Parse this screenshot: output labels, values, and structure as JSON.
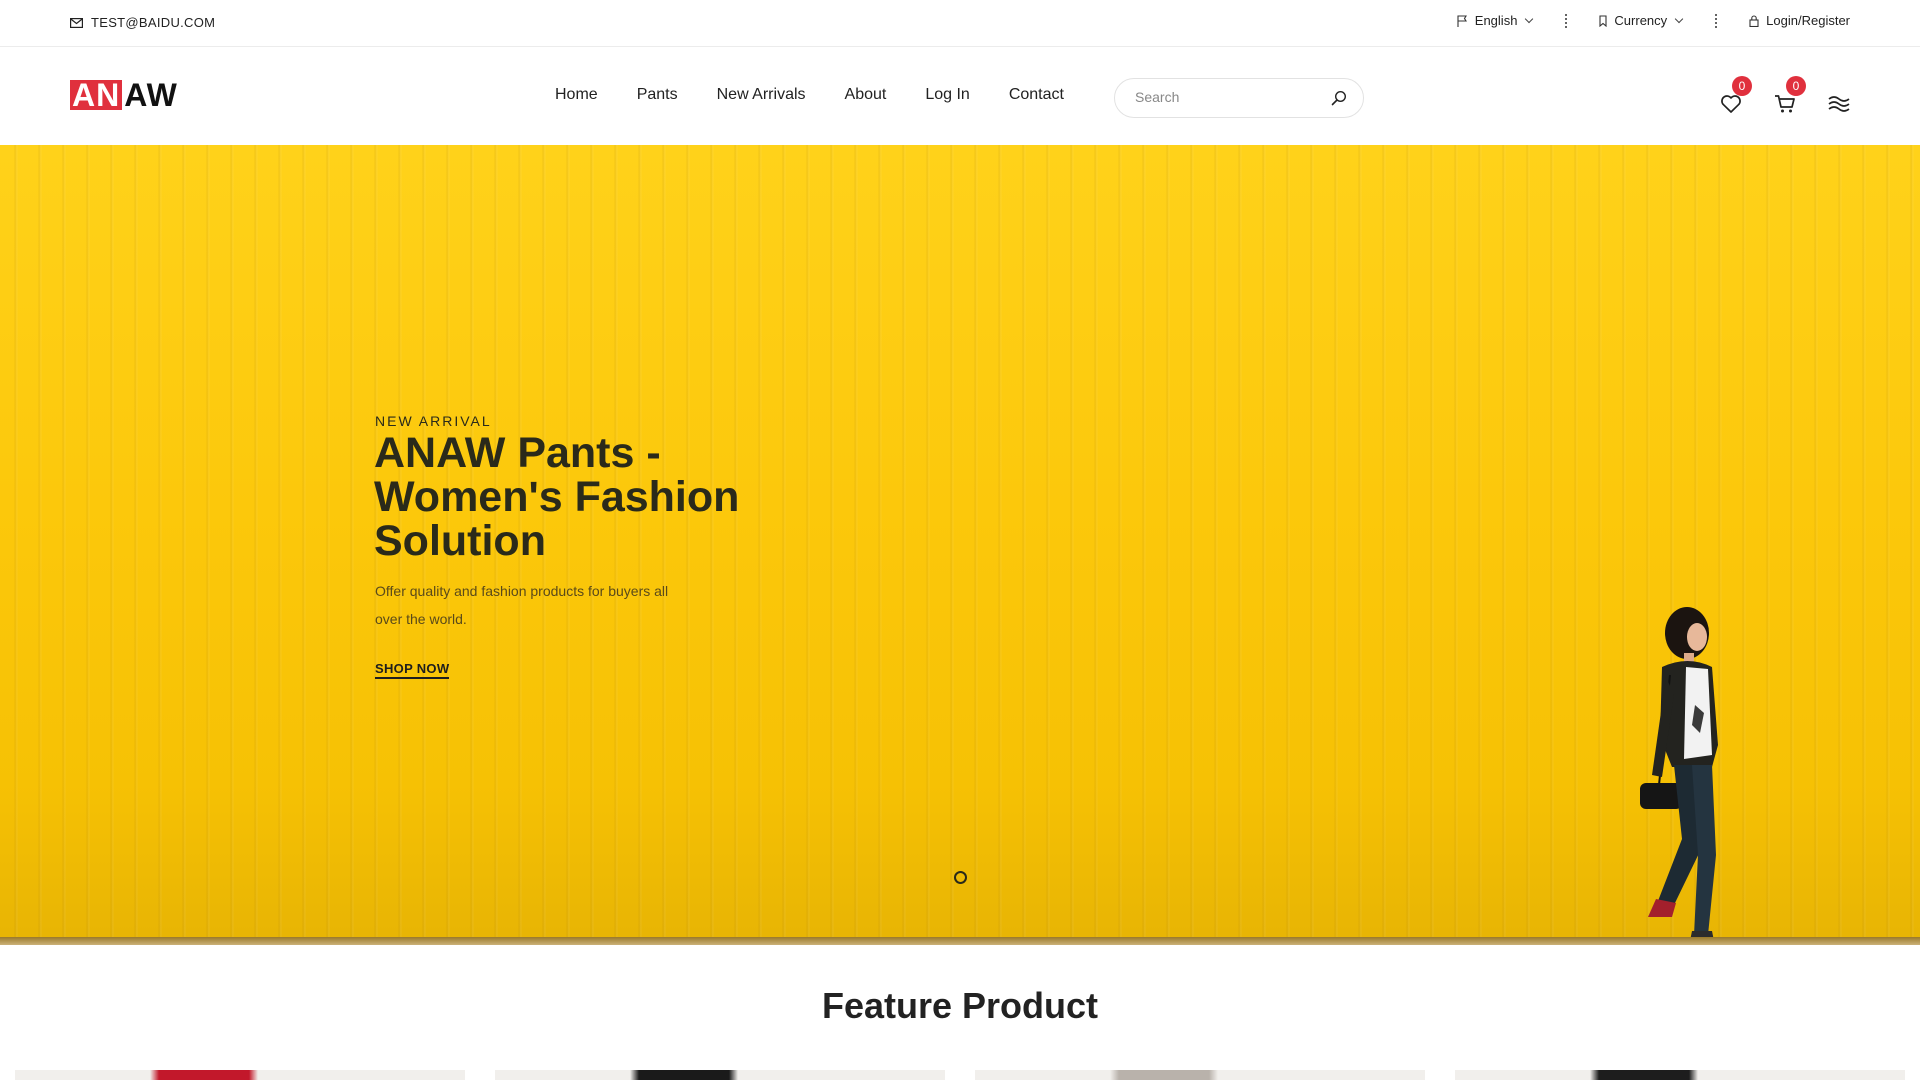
{
  "topbar": {
    "email": "TEST@BAIDU.COM",
    "language": "English",
    "currency": "Currency",
    "login": "Login/Register"
  },
  "header": {
    "logo_part1": "AN",
    "logo_part2": "AW",
    "nav": [
      "Home",
      "Pants",
      "New Arrivals",
      "About",
      "Log In",
      "Contact"
    ],
    "search_placeholder": "Search",
    "wishlist_count": "0",
    "cart_count": "0"
  },
  "hero": {
    "kicker": "NEW ARRIVAL",
    "title": "ANAW Pants - Women's Fashion Solution",
    "description": "Offer quality and fashion products for buyers all over the world.",
    "cta": "SHOP NOW",
    "background_color": "#FCC80B"
  },
  "feature": {
    "title": "Feature Product",
    "card_colors": [
      "#c2182b",
      "#1a1a1a",
      "#b9b2ab",
      "#1d1d1d"
    ]
  },
  "colors": {
    "accent": "#E0303D",
    "text": "#222222"
  }
}
